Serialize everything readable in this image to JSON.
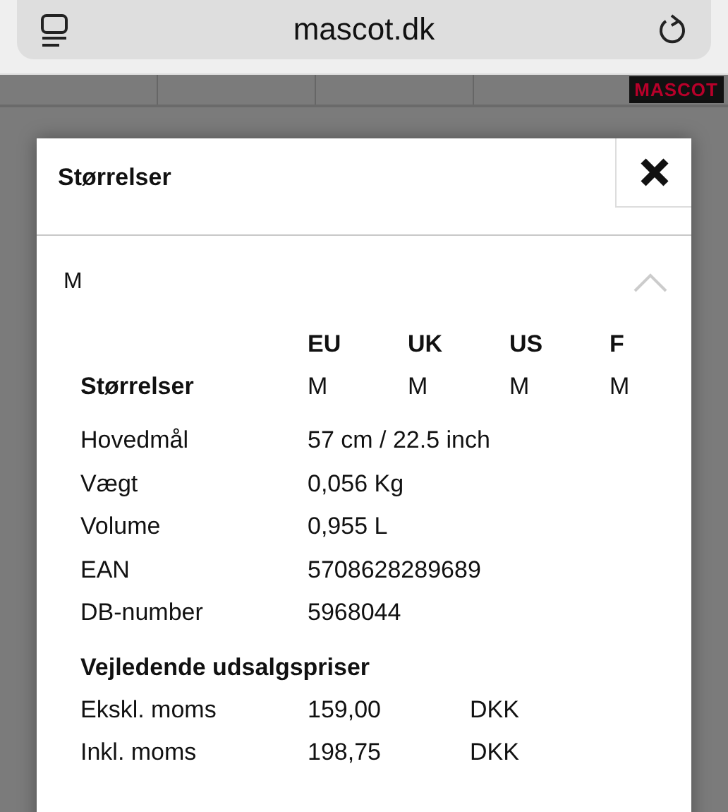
{
  "browser": {
    "url": "mascot.dk"
  },
  "background": {
    "logo": "MASCOT"
  },
  "modal": {
    "title": "Størrelser",
    "size_panel": {
      "label": "M",
      "expanded": true
    },
    "size_table": {
      "columns": [
        "EU",
        "UK",
        "US",
        "F"
      ],
      "row_label": "Størrelser",
      "values": [
        "M",
        "M",
        "M",
        "M"
      ]
    },
    "specs": [
      {
        "label": "Hovedmål",
        "value": "57 cm / 22.5 inch"
      },
      {
        "label": "Vægt",
        "value": "0,056 Kg"
      },
      {
        "label": "Volume",
        "value": "0,955 L"
      },
      {
        "label": "EAN",
        "value": "5708628289689"
      },
      {
        "label": "DB-number",
        "value": "5968044"
      }
    ],
    "prices": {
      "heading": "Vejledende udsalgspriser",
      "rows": [
        {
          "label": "Ekskl. moms",
          "amount": "159,00",
          "currency": "DKK"
        },
        {
          "label": "Inkl. moms",
          "amount": "198,75",
          "currency": "DKK"
        }
      ]
    }
  }
}
